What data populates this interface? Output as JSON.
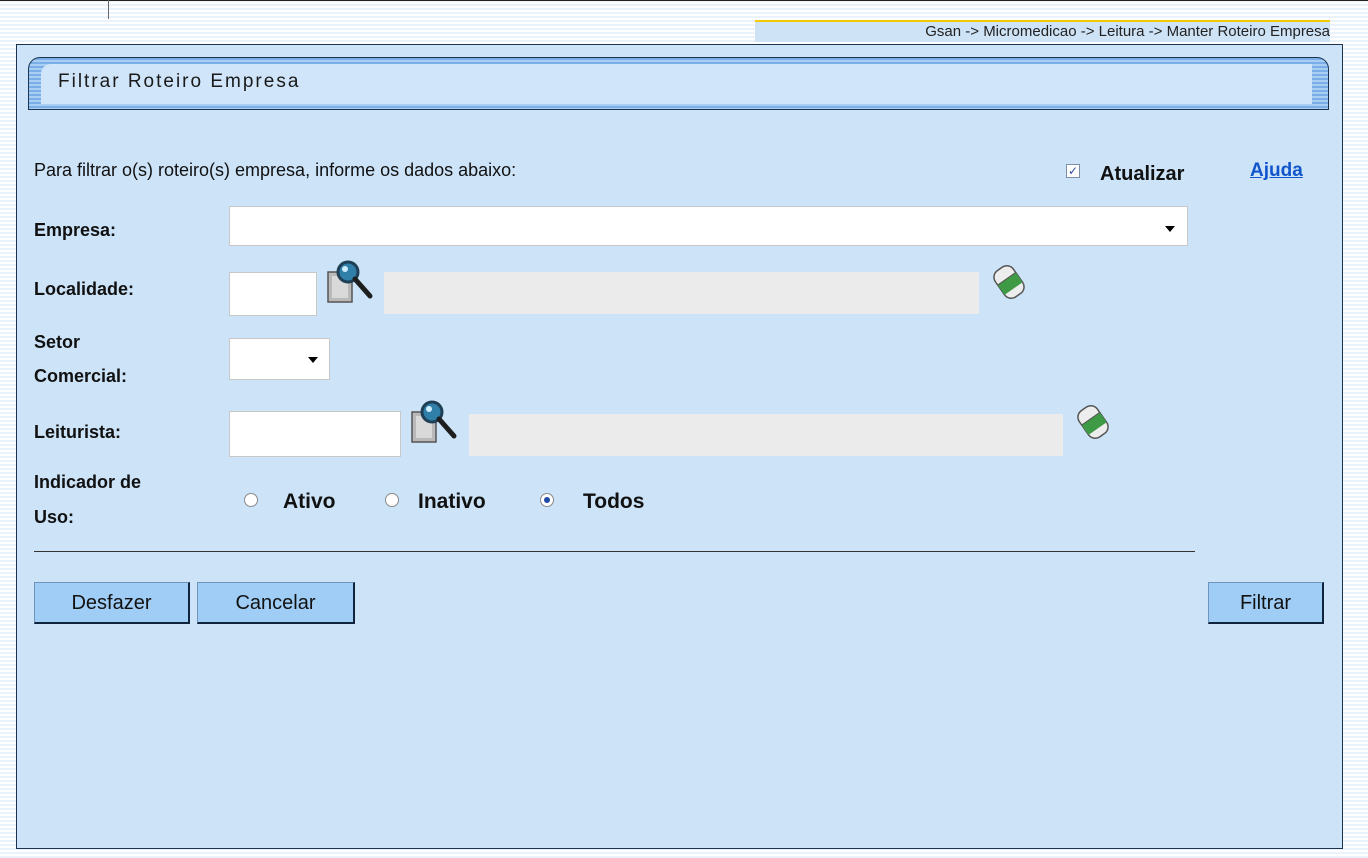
{
  "breadcrumb": "Gsan -> Micromedicao -> Leitura -> Manter Roteiro Empresa",
  "page_title": "Filtrar Roteiro Empresa",
  "instruction": "Para filtrar o(s) roteiro(s) empresa, informe os dados abaixo:",
  "atualizar": {
    "label": "Atualizar",
    "checked": true
  },
  "ajuda_label": "Ajuda",
  "fields": {
    "empresa": {
      "label": "Empresa:",
      "value": ""
    },
    "localidade": {
      "label": "Localidade:",
      "code": "",
      "description": ""
    },
    "setor_comercial": {
      "label_line1": "Setor",
      "label_line2": "Comercial:",
      "value": ""
    },
    "leiturista": {
      "label": "Leiturista:",
      "code": "",
      "description": ""
    },
    "indicador_uso": {
      "label_line1": "Indicador de",
      "label_line2": "Uso:",
      "options": [
        "Ativo",
        "Inativo",
        "Todos"
      ],
      "selected": "Todos"
    }
  },
  "buttons": {
    "desfazer": "Desfazer",
    "cancelar": "Cancelar",
    "filtrar": "Filtrar"
  },
  "icons": {
    "search": "magnifier-search-icon",
    "clear": "eraser-icon"
  },
  "colors": {
    "panel": "#cce3f8",
    "button": "#9fcdf5",
    "link": "#1155cc",
    "breadcrumb_bar": "#f3c900"
  }
}
